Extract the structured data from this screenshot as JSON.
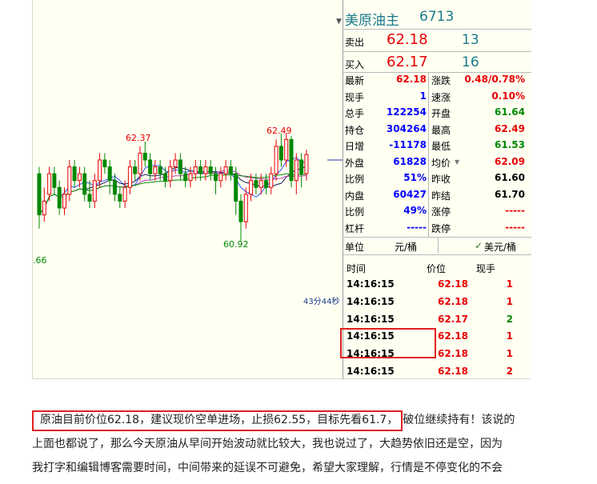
{
  "header": {
    "name": "美原油主",
    "code": "6713"
  },
  "sell": {
    "label": "卖出",
    "price": "62.18",
    "qty": "13"
  },
  "buy": {
    "label": "买入",
    "price": "62.17",
    "qty": "16"
  },
  "quote_left": [
    {
      "label": "最新",
      "value": "62.18",
      "color": "red"
    },
    {
      "label": "现手",
      "value": "1",
      "color": "blue"
    },
    {
      "label": "总手",
      "value": "122254",
      "color": "blue"
    },
    {
      "label": "持仓",
      "value": "304264",
      "color": "blue"
    },
    {
      "label": "日增",
      "value": "-11178",
      "color": "blue"
    },
    {
      "label": "外盘",
      "value": "61828",
      "color": "blue"
    },
    {
      "label": "比例",
      "value": "51%",
      "color": "blue"
    },
    {
      "label": "内盘",
      "value": "60427",
      "color": "blue"
    },
    {
      "label": "比例",
      "value": "49%",
      "color": "blue"
    },
    {
      "label": "杠杆",
      "value": "-----",
      "color": "blue"
    }
  ],
  "quote_right": [
    {
      "label": "涨跌",
      "value": "0.48/0.78%",
      "color": "red"
    },
    {
      "label": "速涨",
      "value": "0.10%",
      "color": "red"
    },
    {
      "label": "开盘",
      "value": "61.64",
      "color": "green"
    },
    {
      "label": "最高",
      "value": "62.49",
      "color": "red"
    },
    {
      "label": "最低",
      "value": "61.53",
      "color": "green"
    },
    {
      "label": "均价",
      "value": "62.09",
      "color": "red"
    },
    {
      "label": "昨收",
      "value": "61.60",
      "color": "black"
    },
    {
      "label": "昨结",
      "value": "61.70",
      "color": "black"
    },
    {
      "label": "涨停",
      "value": "-----",
      "color": "red"
    },
    {
      "label": "跌停",
      "value": "-----",
      "color": "red"
    }
  ],
  "unit": {
    "label": "单位",
    "left": "元/桶",
    "right": "美元/桶",
    "check": "✓"
  },
  "ticks": {
    "headers": [
      "时间",
      "价位",
      "现手"
    ],
    "rows": [
      {
        "time": "14:16:15",
        "price": "62.18",
        "qty": "1",
        "qty_color": "red"
      },
      {
        "time": "14:16:15",
        "price": "62.18",
        "qty": "1",
        "qty_color": "red"
      },
      {
        "time": "14:16:15",
        "price": "62.17",
        "qty": "2",
        "qty_color": "green"
      },
      {
        "time": "14:16:15",
        "price": "62.18",
        "qty": "1",
        "qty_color": "red"
      },
      {
        "time": "14:16:15",
        "price": "62.18",
        "qty": "1",
        "qty_color": "red"
      },
      {
        "time": "14:16:15",
        "price": "62.18",
        "qty": "2",
        "qty_color": "red"
      }
    ]
  },
  "chart": {
    "high_label": "62.49",
    "mid_label": "62.37",
    "low_label": "60.92",
    "left_label": ".66",
    "timer": "43分44秒",
    "candles": [
      {
        "o": 61.9,
        "c": 61.3,
        "h": 62.0,
        "l": 61.1
      },
      {
        "o": 61.3,
        "c": 61.5,
        "h": 61.7,
        "l": 61.2
      },
      {
        "o": 61.6,
        "c": 61.9,
        "h": 62.0,
        "l": 61.5
      },
      {
        "o": 61.9,
        "c": 61.7,
        "h": 62.0,
        "l": 61.6
      },
      {
        "o": 61.7,
        "c": 61.4,
        "h": 61.8,
        "l": 61.3
      },
      {
        "o": 61.4,
        "c": 61.6,
        "h": 61.7,
        "l": 61.3
      },
      {
        "o": 61.6,
        "c": 62.0,
        "h": 62.1,
        "l": 61.5
      },
      {
        "o": 62.0,
        "c": 61.8,
        "h": 62.1,
        "l": 61.7
      },
      {
        "o": 61.8,
        "c": 61.9,
        "h": 62.0,
        "l": 61.7
      },
      {
        "o": 61.9,
        "c": 61.6,
        "h": 62.0,
        "l": 61.5
      },
      {
        "o": 61.6,
        "c": 61.5,
        "h": 61.8,
        "l": 61.4
      },
      {
        "o": 61.5,
        "c": 61.8,
        "h": 61.9,
        "l": 61.4
      },
      {
        "o": 61.8,
        "c": 62.1,
        "h": 62.2,
        "l": 61.7
      },
      {
        "o": 62.1,
        "c": 62.0,
        "h": 62.2,
        "l": 61.9
      },
      {
        "o": 62.0,
        "c": 61.8,
        "h": 62.1,
        "l": 61.6
      },
      {
        "o": 61.8,
        "c": 61.6,
        "h": 61.9,
        "l": 61.5
      },
      {
        "o": 61.6,
        "c": 61.5,
        "h": 61.7,
        "l": 61.4
      },
      {
        "o": 61.5,
        "c": 61.7,
        "h": 61.8,
        "l": 61.4
      },
      {
        "o": 61.7,
        "c": 62.0,
        "h": 62.1,
        "l": 61.6
      },
      {
        "o": 62.0,
        "c": 61.9,
        "h": 62.1,
        "l": 61.8
      },
      {
        "o": 61.9,
        "c": 62.2,
        "h": 62.3,
        "l": 61.8
      },
      {
        "o": 62.2,
        "c": 62.1,
        "h": 62.37,
        "l": 62.0
      },
      {
        "o": 62.1,
        "c": 61.9,
        "h": 62.2,
        "l": 61.8
      },
      {
        "o": 61.9,
        "c": 62.0,
        "h": 62.1,
        "l": 61.8
      },
      {
        "o": 62.0,
        "c": 61.9,
        "h": 62.1,
        "l": 61.8
      },
      {
        "o": 61.9,
        "c": 61.8,
        "h": 62.0,
        "l": 61.7
      },
      {
        "o": 61.8,
        "c": 62.0,
        "h": 62.1,
        "l": 61.7
      },
      {
        "o": 62.0,
        "c": 62.1,
        "h": 62.2,
        "l": 61.9
      },
      {
        "o": 62.1,
        "c": 61.9,
        "h": 62.2,
        "l": 61.8
      },
      {
        "o": 61.9,
        "c": 61.8,
        "h": 62.0,
        "l": 61.7
      },
      {
        "o": 61.8,
        "c": 61.9,
        "h": 62.0,
        "l": 61.7
      },
      {
        "o": 61.9,
        "c": 62.0,
        "h": 62.1,
        "l": 61.8
      },
      {
        "o": 62.0,
        "c": 61.9,
        "h": 62.1,
        "l": 61.8
      },
      {
        "o": 61.9,
        "c": 62.0,
        "h": 62.1,
        "l": 61.8
      },
      {
        "o": 62.0,
        "c": 61.9,
        "h": 62.1,
        "l": 61.8
      },
      {
        "o": 61.9,
        "c": 61.8,
        "h": 62.0,
        "l": 61.6
      },
      {
        "o": 61.8,
        "c": 61.9,
        "h": 62.0,
        "l": 61.7
      },
      {
        "o": 61.9,
        "c": 62.0,
        "h": 62.1,
        "l": 61.8
      },
      {
        "o": 62.0,
        "c": 61.9,
        "h": 62.1,
        "l": 61.8
      },
      {
        "o": 61.9,
        "c": 61.5,
        "h": 62.0,
        "l": 61.3
      },
      {
        "o": 61.5,
        "c": 61.2,
        "h": 61.6,
        "l": 60.92
      },
      {
        "o": 61.2,
        "c": 61.6,
        "h": 61.7,
        "l": 61.1
      },
      {
        "o": 61.6,
        "c": 61.8,
        "h": 61.9,
        "l": 61.5
      },
      {
        "o": 61.8,
        "c": 61.7,
        "h": 61.9,
        "l": 61.6
      },
      {
        "o": 61.7,
        "c": 61.8,
        "h": 61.9,
        "l": 61.6
      },
      {
        "o": 61.8,
        "c": 61.7,
        "h": 61.9,
        "l": 61.6
      },
      {
        "o": 61.7,
        "c": 61.9,
        "h": 62.0,
        "l": 61.6
      },
      {
        "o": 61.9,
        "c": 62.3,
        "h": 62.4,
        "l": 61.8
      },
      {
        "o": 62.3,
        "c": 62.1,
        "h": 62.49,
        "l": 62.0
      },
      {
        "o": 62.1,
        "c": 62.4,
        "h": 62.49,
        "l": 62.0
      },
      {
        "o": 62.4,
        "c": 61.8,
        "h": 62.45,
        "l": 61.7
      },
      {
        "o": 61.8,
        "c": 62.1,
        "h": 62.2,
        "l": 61.6
      },
      {
        "o": 62.1,
        "c": 61.9,
        "h": 62.2,
        "l": 61.7
      },
      {
        "o": 61.9,
        "c": 62.18,
        "h": 62.25,
        "l": 61.8
      }
    ]
  },
  "caption": {
    "highlight": "原油目前价位62.18，建议现价空单进场，止损62.55，目标先看61.7，",
    "rest1": "破位继续持有！该说的",
    "line2": "上面也都说了，那么今天原油从早间开始波动就比较大，我也说过了，大趋势依旧还是空，因为",
    "line3": "我打字和编辑博客需要时间，中间带来的延误不可避免，希望大家理解，行情是不停变化的不会"
  }
}
